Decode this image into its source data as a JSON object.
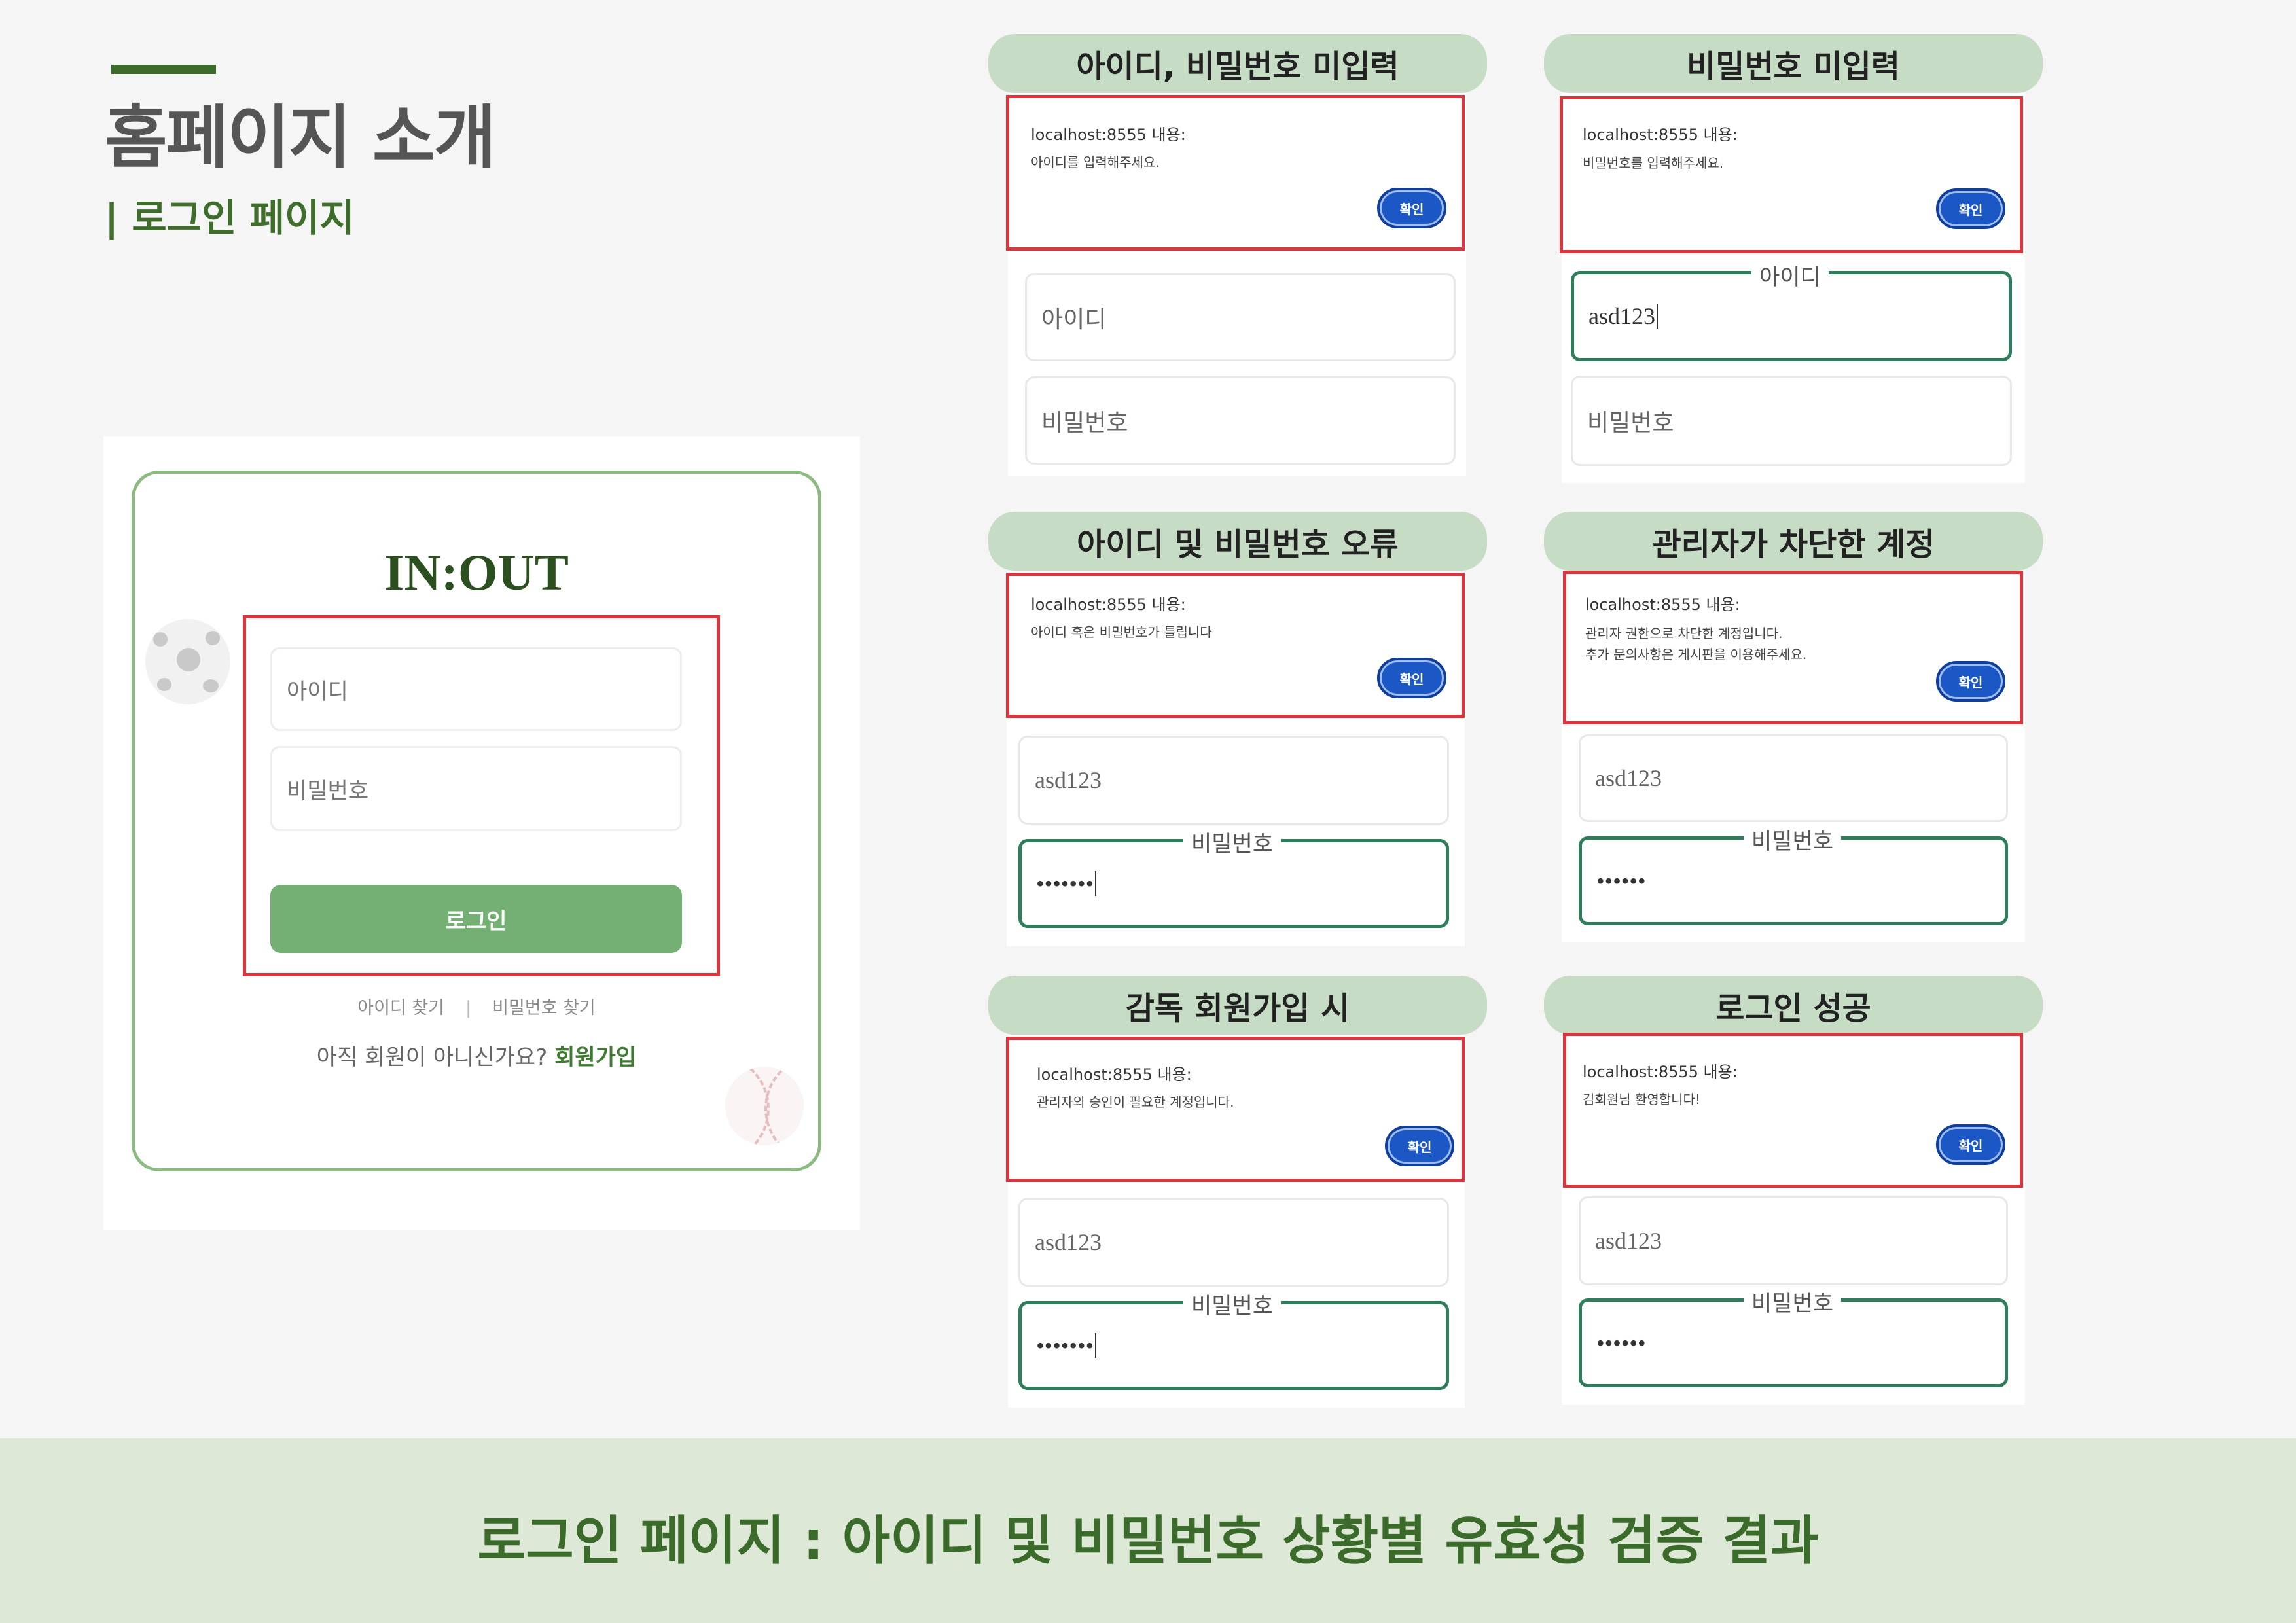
{
  "header": {
    "title": "홈페이지 소개",
    "subtitle": "| 로그인 페이지"
  },
  "login": {
    "logo": "IN:OUT",
    "id_placeholder": "아이디",
    "pw_placeholder": "비밀번호",
    "login_button": "로그인",
    "find_id": "아이디 찾기",
    "separator": "|",
    "find_pw": "비밀번호 찾기",
    "signup_prompt": "아직 회원이 아니신가요?",
    "signup_link": "회원가입"
  },
  "colors": {
    "accent_green": "#3b6b2a",
    "pill_bg": "#c7dcc4",
    "highlight_red": "#d9363e",
    "ok_button_blue": "#1b58c5",
    "banner_bg": "#dde8d6"
  },
  "scenarios": [
    {
      "title": "아이디, 비밀번호 미입력",
      "alert_host": "localhost:8555 내용:",
      "alert_lines": [
        "아이디를 입력해주세요."
      ],
      "ok": "확인",
      "field1": "아이디",
      "field2": "비밀번호"
    },
    {
      "title": "비밀번호 미입력",
      "alert_host": "localhost:8555 내용:",
      "alert_lines": [
        "비밀번호를 입력해주세요."
      ],
      "ok": "확인",
      "field1_label": "아이디",
      "field1": "asd123",
      "field2": "비밀번호"
    },
    {
      "title": "아이디 및 비밀번호 오류",
      "alert_host": "localhost:8555 내용:",
      "alert_lines": [
        "아이디 혹은 비밀번호가 틀립니다"
      ],
      "ok": "확인",
      "field1": "asd123",
      "field2_label": "비밀번호",
      "field2": "•••••••"
    },
    {
      "title": "관리자가 차단한 계정",
      "alert_host": "localhost:8555 내용:",
      "alert_lines": [
        "관리자 권한으로 차단한 계정입니다.",
        "추가 문의사항은 게시판을 이용해주세요."
      ],
      "ok": "확인",
      "field1": "asd123",
      "field2_label": "비밀번호",
      "field2": "••••••"
    },
    {
      "title": "감독 회원가입 시",
      "alert_host": "localhost:8555 내용:",
      "alert_lines": [
        "관리자의 승인이 필요한 계정입니다."
      ],
      "ok": "확인",
      "field1": "asd123",
      "field2_label": "비밀번호",
      "field2": "•••••••"
    },
    {
      "title": "로그인 성공",
      "alert_host": "localhost:8555 내용:",
      "alert_lines": [
        "김회원님 환영합니다!"
      ],
      "ok": "확인",
      "field1": "asd123",
      "field2_label": "비밀번호",
      "field2": "••••••"
    }
  ],
  "footer": {
    "banner": "로그인 페이지 : 아이디 및 비밀번호 상황별 유효성 검증 결과"
  }
}
